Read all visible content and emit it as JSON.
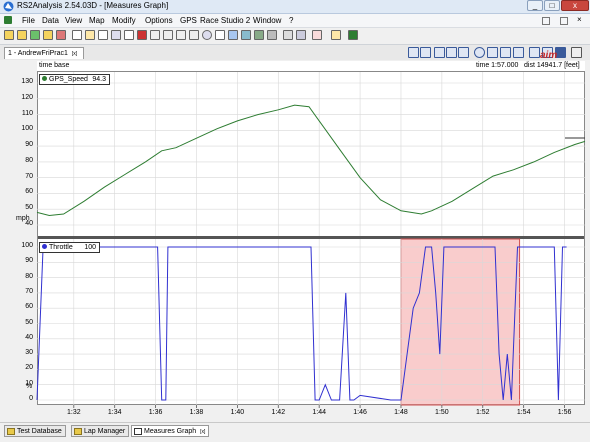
{
  "window": {
    "title": "RS2Analysis 2.54.03D - [Measures Graph]",
    "controls": [
      "_",
      "□",
      "x"
    ]
  },
  "menu": [
    "File",
    "Data",
    "View",
    "Map",
    "Modify",
    "Options",
    "GPS",
    "Race Studio 2",
    "Window",
    "?"
  ],
  "doc_tab": {
    "label": "1 - AndrewFriPrac1",
    "close": "[x]"
  },
  "info_bar": {
    "left_label": "time base",
    "time_text": "time 1:57.000",
    "dist_text": "dist 14941.7 [feet]"
  },
  "brand": "aim",
  "speed_panel": {
    "legend_name": "GPS_Speed",
    "legend_value": "94.3",
    "unit_label": "mph",
    "color": "#2e7d32"
  },
  "throttle_panel": {
    "legend_name": "Throttle",
    "legend_value": "100",
    "unit_label": "%",
    "color": "#3030d0"
  },
  "highlight_color": "#f4a3a3",
  "chart_data": [
    {
      "type": "line",
      "series": [
        {
          "name": "GPS_Speed",
          "x": [
            "1:30.2",
            "1:30.8",
            "1:31.5",
            "1:32.5",
            "1:33.5",
            "1:34.5",
            "1:35.5",
            "1:36.3",
            "1:37.0",
            "1:38.0",
            "1:39.0",
            "1:40.0",
            "1:41.0",
            "1:42.0",
            "1:42.8",
            "1:43.5",
            "1:44.0",
            "1:45.0",
            "1:46.0",
            "1:47.0",
            "1:48.0",
            "1:49.0",
            "1:49.5",
            "1:50.5",
            "1:51.5",
            "1:52.5",
            "1:53.5",
            "1:54.5",
            "1:55.5",
            "1:56.5",
            "1:57.0"
          ],
          "y": [
            48,
            46,
            47,
            55,
            64,
            72,
            80,
            87,
            89,
            95,
            101,
            106,
            110,
            113,
            116,
            115,
            106,
            88,
            70,
            56,
            49,
            47,
            49,
            55,
            63,
            71,
            75,
            80,
            86,
            91,
            93
          ]
        }
      ],
      "ylim": [
        40,
        130
      ],
      "yticks": [
        "40",
        "50",
        "60",
        "70",
        "80",
        "90",
        "100",
        "110",
        "120",
        "130"
      ],
      "ylabel": "mph"
    },
    {
      "type": "line",
      "series": [
        {
          "name": "Throttle",
          "x": [
            "1:30.2",
            "1:30.5",
            "1:30.6",
            "1:36.1",
            "1:36.3",
            "1:36.5",
            "1:36.6",
            "1:43.6",
            "1:43.8",
            "1:44.0",
            "1:44.3",
            "1:44.6",
            "1:45.0",
            "1:45.3",
            "1:45.5",
            "1:45.7",
            "1:46.0",
            "1:47.5",
            "1:48.0",
            "1:48.3",
            "1:48.6",
            "1:48.9",
            "1:49.2",
            "1:49.5",
            "1:49.7",
            "1:49.9",
            "1:50.1",
            "1:50.3",
            "1:50.5",
            "1:50.8",
            "1:51.0",
            "1:52.6",
            "1:52.8",
            "1:53.0",
            "1:53.2",
            "1:53.4",
            "1:53.7",
            "1:55.5",
            "1:55.7",
            "1:55.9",
            "1:56.1"
          ],
          "y": [
            0,
            100,
            100,
            100,
            0,
            0,
            100,
            100,
            0,
            0,
            10,
            0,
            0,
            70,
            0,
            0,
            3,
            0,
            0,
            30,
            60,
            70,
            100,
            100,
            70,
            30,
            100,
            100,
            100,
            100,
            100,
            100,
            30,
            0,
            30,
            0,
            100,
            100,
            0,
            100,
            100
          ]
        }
      ],
      "ylim": [
        0,
        100
      ],
      "yticks": [
        "0",
        "10",
        "20",
        "30",
        "40",
        "50",
        "60",
        "70",
        "80",
        "90",
        "100"
      ],
      "ylabel": "%",
      "highlight_range": [
        "1:48.0",
        "1:53.8"
      ]
    }
  ],
  "x_axis": {
    "ticks": [
      "1:32",
      "1:34",
      "1:36",
      "1:38",
      "1:40",
      "1:42",
      "1:44",
      "1:46",
      "1:48",
      "1:50",
      "1:52",
      "1:54",
      "1:56"
    ]
  },
  "status_tabs": [
    {
      "label": "Test Database"
    },
    {
      "label": "Lap Manager"
    },
    {
      "label": "Measures Graph",
      "close": "[x]"
    }
  ]
}
